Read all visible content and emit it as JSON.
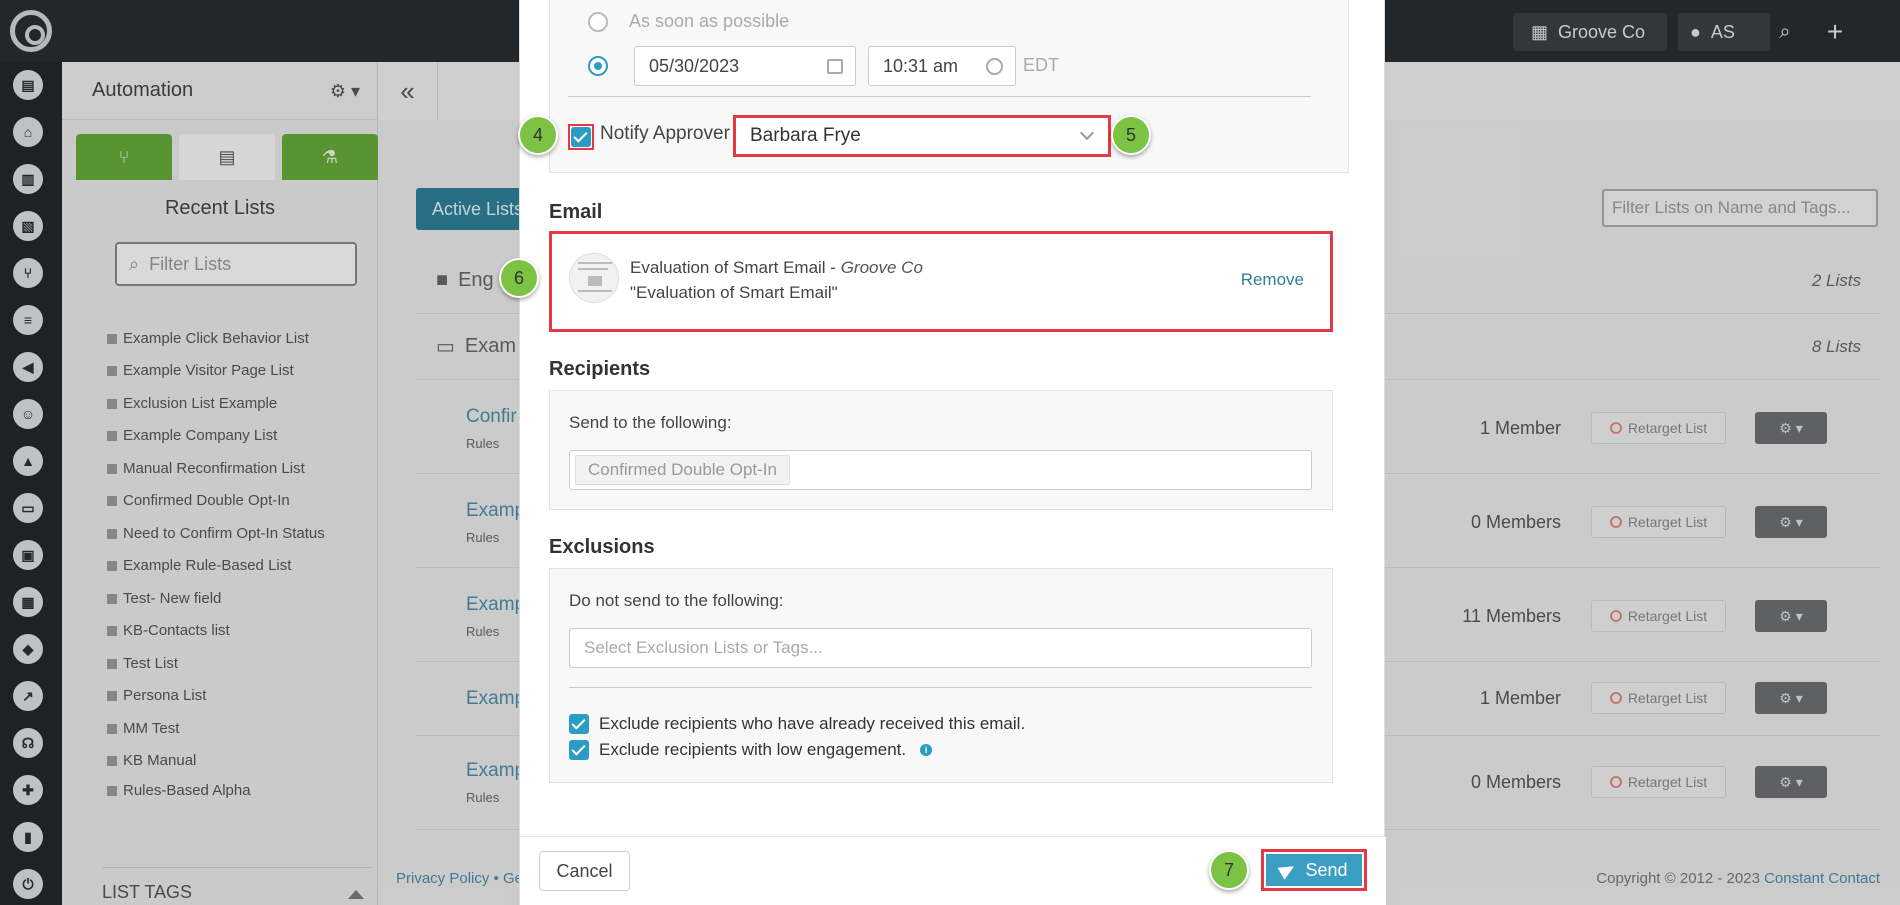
{
  "topbar": {
    "account_label": "Groove Co",
    "user_initials": "AS"
  },
  "sidebar": {
    "title": "Automation",
    "recent_title": "Recent Lists",
    "filter_placeholder": "Filter Lists",
    "recent_lists": [
      "Example Click Behavior List",
      "Example Visitor Page List",
      "Exclusion List Example",
      "Example Company List",
      "Manual Reconfirmation List",
      "Confirmed Double Opt-In",
      "Need to Confirm Opt-In Status",
      "Example Rule-Based List",
      "Test- New field",
      "KB-Contacts list",
      "Test List",
      "Persona List",
      "MM Test",
      "KB Manual",
      "Rules-Based Alpha"
    ],
    "list_tags_label": "LIST TAGS"
  },
  "main": {
    "active_lists_label": "Active Lists",
    "filter_placeholder": "Filter Lists on Name and Tags...",
    "folders": [
      {
        "name": "Eng",
        "count": "2 Lists"
      },
      {
        "name": "Exam",
        "count": "8 Lists"
      }
    ],
    "rows": [
      {
        "name": "Confir",
        "rules": "Rules",
        "members": "1 Member"
      },
      {
        "name": "Examp",
        "rules": "Rules",
        "members": "0 Members"
      },
      {
        "name": "Examp",
        "rules": "Rules",
        "members": "11 Members"
      },
      {
        "name": "Examp",
        "rules": "",
        "members": "1 Member"
      },
      {
        "name": "Examp",
        "rules": "Rules",
        "members": "0 Members"
      }
    ],
    "retarget_label": "Retarget List",
    "footer_left": "Privacy Policy • Ge",
    "footer_right_prefix": "Copyright © 2012 - 2023 ",
    "footer_right_link": "Constant Contact"
  },
  "modal": {
    "schedule": {
      "asap_label": "As soon as possible",
      "date": "05/30/2023",
      "time": "10:31 am",
      "timezone": "EDT"
    },
    "notify": {
      "label": "Notify Approver",
      "approver": "Barbara Frye"
    },
    "email": {
      "section_title": "Email",
      "name": "Evaluation of Smart Email - ",
      "account": "Groove Co",
      "subject": "\"Evaluation of Smart Email\"",
      "remove_label": "Remove"
    },
    "recipients": {
      "section_title": "Recipients",
      "label": "Send to the following:",
      "chip": "Confirmed Double Opt-In"
    },
    "exclusions": {
      "section_title": "Exclusions",
      "label": "Do not send to the following:",
      "placeholder": "Select Exclusion Lists or Tags...",
      "opt1": "Exclude recipients who have already received this email.",
      "opt2": "Exclude recipients with low engagement."
    },
    "footer": {
      "cancel_label": "Cancel",
      "send_label": "Send"
    }
  },
  "markers": [
    "4",
    "5",
    "6",
    "7"
  ],
  "colors": {
    "accent": "#3a9fc2",
    "highlight": "#e53945",
    "marker": "#7cc243",
    "tab_green": "#66a93a"
  }
}
